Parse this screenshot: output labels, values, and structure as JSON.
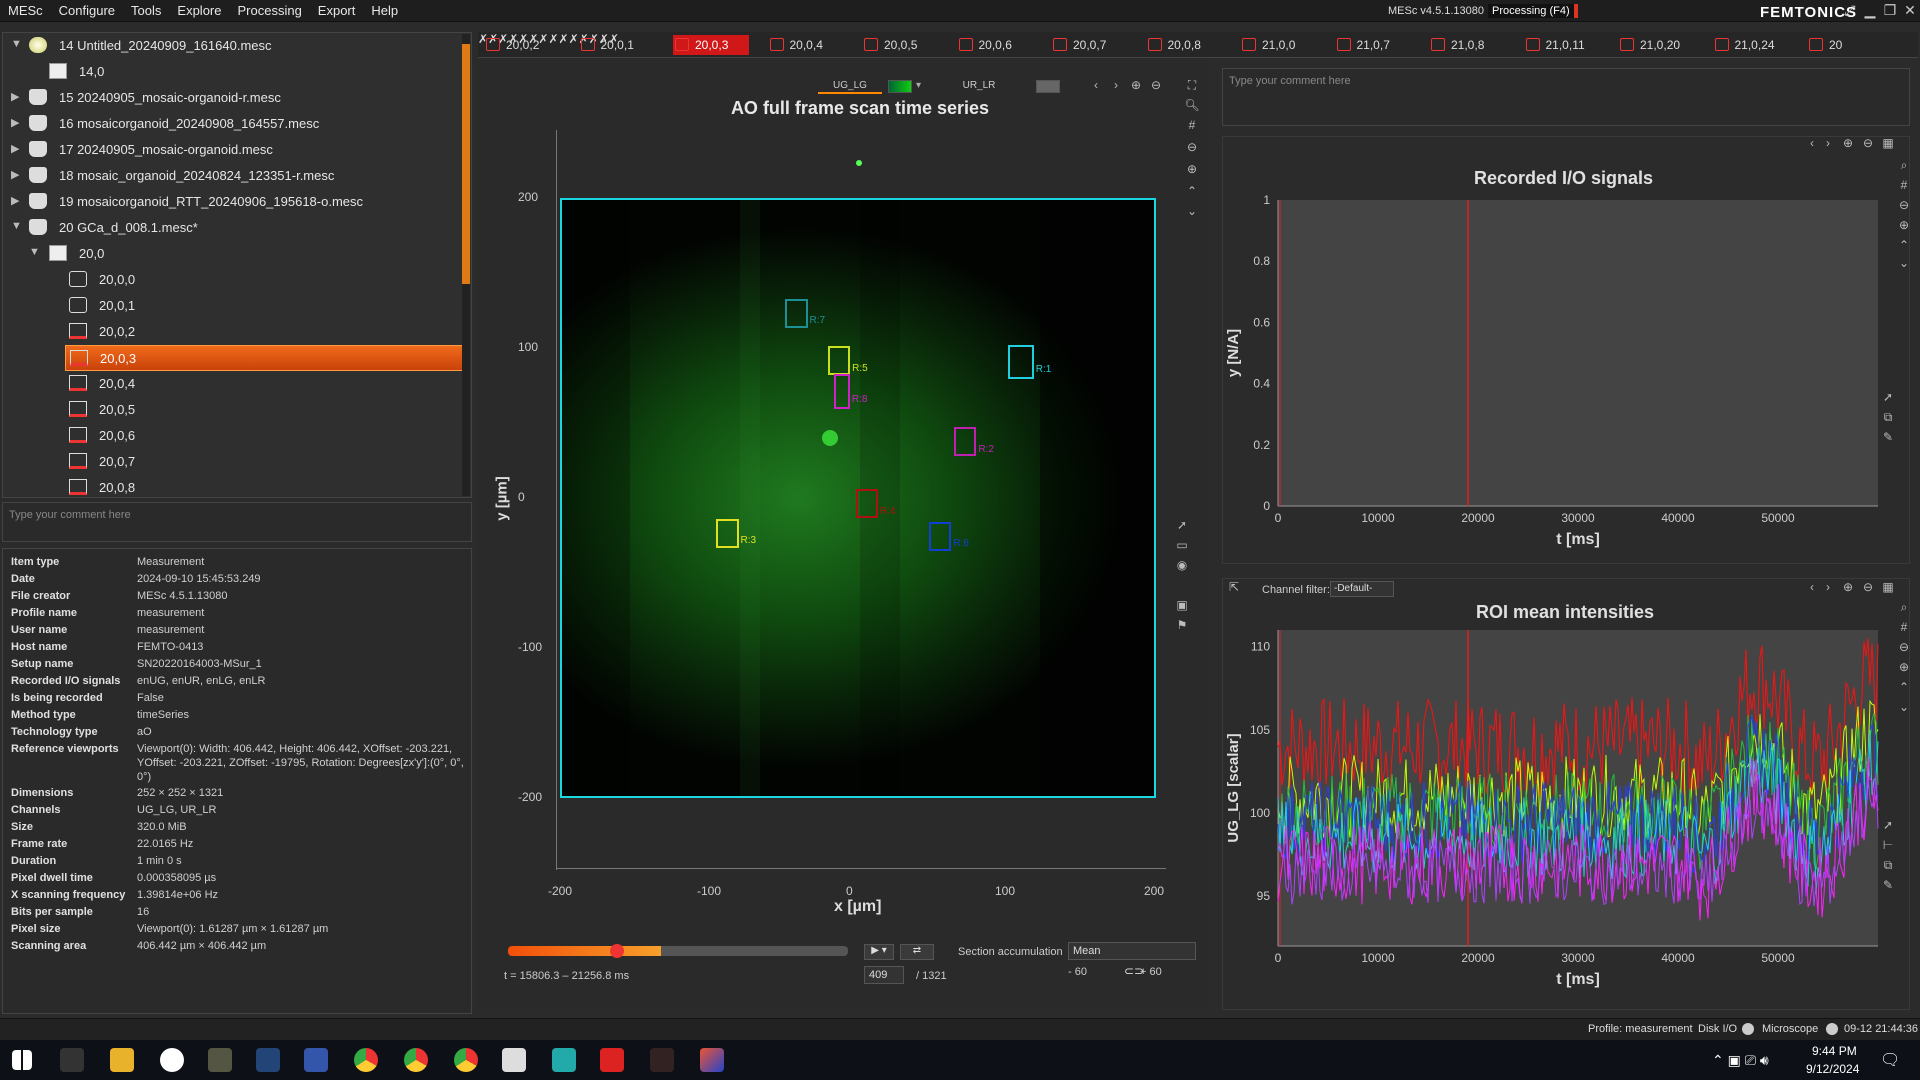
{
  "menu": [
    "MESc",
    "Configure",
    "Tools",
    "Explore",
    "Processing",
    "Export",
    "Help"
  ],
  "app": {
    "version": "MESc v4.5.1.13080",
    "processing": "Processing (F4)",
    "brand": "FEMTONICS"
  },
  "tree": [
    {
      "label": "14 Untitled_20240909_161640.mesc",
      "indent": 0,
      "arrow": "▼",
      "icon": "sun-icon",
      "sel": false
    },
    {
      "label": "14,0",
      "indent": 1,
      "arrow": "",
      "icon": "measurement-icon",
      "sel": false
    },
    {
      "label": "15 20240905_mosaic-organoid-r.mesc",
      "indent": 0,
      "arrow": "▶",
      "icon": "disk-icon",
      "sel": false
    },
    {
      "label": "16 mosaicorganoid_20240908_164557.mesc",
      "indent": 0,
      "arrow": "▶",
      "icon": "disk-icon",
      "sel": false
    },
    {
      "label": "17 20240905_mosaic-organoid.mesc",
      "indent": 0,
      "arrow": "▶",
      "icon": "disk-icon",
      "sel": false
    },
    {
      "label": "18 mosaic_organoid_20240824_123351-r.mesc",
      "indent": 0,
      "arrow": "▶",
      "icon": "disk-icon",
      "sel": false
    },
    {
      "label": "19 mosaicorganoid_RTT_20240906_195618-o.mesc",
      "indent": 0,
      "arrow": "▶",
      "icon": "disk-icon",
      "sel": false
    },
    {
      "label": "20 GCa_d_008.1.mesc*",
      "indent": 0,
      "arrow": "▼",
      "icon": "disk-icon",
      "sel": false
    },
    {
      "label": "20,0",
      "indent": 1,
      "arrow": "▼",
      "icon": "measurement-icon",
      "sel": false
    },
    {
      "label": "20,0,0",
      "indent": 2,
      "arrow": "",
      "icon": "camera-icon",
      "sel": false
    },
    {
      "label": "20,0,1",
      "indent": 2,
      "arrow": "",
      "icon": "camera-icon",
      "sel": false
    },
    {
      "label": "20,0,2",
      "indent": 2,
      "arrow": "",
      "icon": "timeseries-icon",
      "sel": false
    },
    {
      "label": "20,0,3",
      "indent": 2,
      "arrow": "",
      "icon": "timeseries-icon",
      "sel": true
    },
    {
      "label": "20,0,4",
      "indent": 2,
      "arrow": "",
      "icon": "timeseries-icon",
      "sel": false
    },
    {
      "label": "20,0,5",
      "indent": 2,
      "arrow": "",
      "icon": "timeseries-icon",
      "sel": false
    },
    {
      "label": "20,0,6",
      "indent": 2,
      "arrow": "",
      "icon": "timeseries-icon",
      "sel": false
    },
    {
      "label": "20,0,7",
      "indent": 2,
      "arrow": "",
      "icon": "timeseries-icon",
      "sel": false
    },
    {
      "label": "20,0,8",
      "indent": 2,
      "arrow": "",
      "icon": "timeseries-icon",
      "sel": false
    }
  ],
  "comment_placeholder": "Type your comment here",
  "properties": [
    [
      "Item type",
      "Measurement"
    ],
    [
      "Date",
      "2024-09-10 15:45:53.249"
    ],
    [
      "File creator",
      "MESc 4.5.1.13080"
    ],
    [
      "Profile name",
      "measurement"
    ],
    [
      "User name",
      "measurement"
    ],
    [
      "Host name",
      "FEMTO-0413"
    ],
    [
      "Setup name",
      "SN20220164003-MSur_1"
    ],
    [
      "Recorded I/O signals",
      "enUG, enUR, enLG, enLR"
    ],
    [
      "Is being recorded",
      "False"
    ],
    [
      "Method type",
      "timeSeries"
    ],
    [
      "Technology type",
      "aO"
    ],
    [
      "Reference viewports",
      "Viewport(0): Width: 406.442, Height: 406.442, XOffset: -203.221, YOffset: -203.221, ZOffset: -19795, Rotation: Degrees[zx'y']:(0°, 0°, 0°)"
    ],
    [
      "Dimensions",
      "252 × 252 × 1321"
    ],
    [
      "Channels",
      "UG_LG, UR_LR"
    ],
    [
      "Size",
      "320.0 MiB"
    ],
    [
      "Frame rate",
      "22.0165 Hz"
    ],
    [
      "Duration",
      "1 min 0 s"
    ],
    [
      "Pixel dwell time",
      "0.000358095 µs"
    ],
    [
      "X scanning frequency",
      "1.39814e+06 Hz"
    ],
    [
      "Bits per sample",
      "16"
    ],
    [
      "Pixel size",
      "Viewport(0): 1.61287 µm × 1.61287 µm"
    ],
    [
      "Scanning area",
      "406.442 µm × 406.442 µm"
    ]
  ],
  "tabs": [
    "20,0,2",
    "20,0,1",
    "20,0,3",
    "20,0,4",
    "20,0,5",
    "20,0,6",
    "20,0,7",
    "20,0,8",
    "21,0,0",
    "21,0,7",
    "21,0,8",
    "21,0,11",
    "21,0,20",
    "21,0,24",
    "20"
  ],
  "active_tab": "20,0,3",
  "viewer": {
    "channel_a": "UG_LG",
    "channel_b": "UR_LR",
    "title": "AO full frame scan time series",
    "x_label": "x [µm]",
    "y_label": "y [µm]",
    "x_ticks": [
      "-200",
      "-100",
      "0",
      "100",
      "200"
    ],
    "y_ticks": [
      "200",
      "100",
      "0",
      "-100",
      "-200"
    ],
    "rois": [
      {
        "id": "R:7",
        "color": "#1e8f96"
      },
      {
        "id": "R:5",
        "color": "#c8e020"
      },
      {
        "id": "R:8",
        "color": "#d020c8"
      },
      {
        "id": "R:1",
        "color": "#20d0e0"
      },
      {
        "id": "R:2",
        "color": "#c020b0"
      },
      {
        "id": "R:4",
        "color": "#b01010"
      },
      {
        "id": "R:6",
        "color": "#1040d0"
      },
      {
        "id": "R:3",
        "color": "#e0e020"
      }
    ],
    "time_range": "t = 15806.3 – 21256.8 ms",
    "progress": 0.33,
    "section_accumulation_label": "Section accumulation",
    "accumulation_mode": "Mean",
    "frame": "409",
    "frame_total": "/ 1321",
    "acc_minus": "- 60",
    "acc_plus": "+ 60"
  },
  "io_plot": {
    "title": "Recorded I/O signals",
    "ylabel": "y [N/A]",
    "xlabel": "t [ms]",
    "y_ticks": [
      "1",
      "0.8",
      "0.6",
      "0.4",
      "0.2",
      "0"
    ],
    "x_ticks": [
      "0",
      "10000",
      "20000",
      "30000",
      "40000",
      "50000"
    ]
  },
  "roi_plot": {
    "title": "ROI mean intensities",
    "ylabel": "UG_LG [scalar]",
    "xlabel": "t [ms]",
    "y_ticks": [
      "110",
      "105",
      "100",
      "95"
    ],
    "x_ticks": [
      "0",
      "10000",
      "20000",
      "30000",
      "40000",
      "50000"
    ],
    "channel_filter_label": "Channel filter:",
    "channel_filter_value": "-Default-"
  },
  "chart_data": [
    {
      "type": "line",
      "title": "Recorded I/O signals",
      "xlabel": "t [ms]",
      "ylabel": "y [N/A]",
      "xlim": [
        0,
        60000
      ],
      "ylim": [
        0,
        1
      ],
      "series": []
    },
    {
      "type": "line",
      "title": "ROI mean intensities",
      "xlabel": "t [ms]",
      "ylabel": "UG_LG [scalar]",
      "xlim": [
        0,
        60000
      ],
      "ylim": [
        92,
        111
      ],
      "series": [
        {
          "color": "#ff1010",
          "level": 104,
          "spread": 3.0
        },
        {
          "color": "#c0ff00",
          "level": 101,
          "spread": 2.5
        },
        {
          "color": "#20c040",
          "level": 100,
          "spread": 2.5
        },
        {
          "color": "#2040ff",
          "level": 99.5,
          "spread": 2.5
        },
        {
          "color": "#20d0e0",
          "level": 98.5,
          "spread": 2.5
        },
        {
          "color": "#ff20ff",
          "level": 97,
          "spread": 2.5
        },
        {
          "color": "#b040ff",
          "level": 96.5,
          "spread": 2.0
        }
      ]
    }
  ],
  "status": {
    "profile": "Profile: measurement",
    "disk": "Disk I/O",
    "microscope": "Microscope",
    "datetime": "09-12 21:44:36"
  },
  "taskbar": {
    "time": "9:44 PM",
    "date": "9/12/2024"
  }
}
